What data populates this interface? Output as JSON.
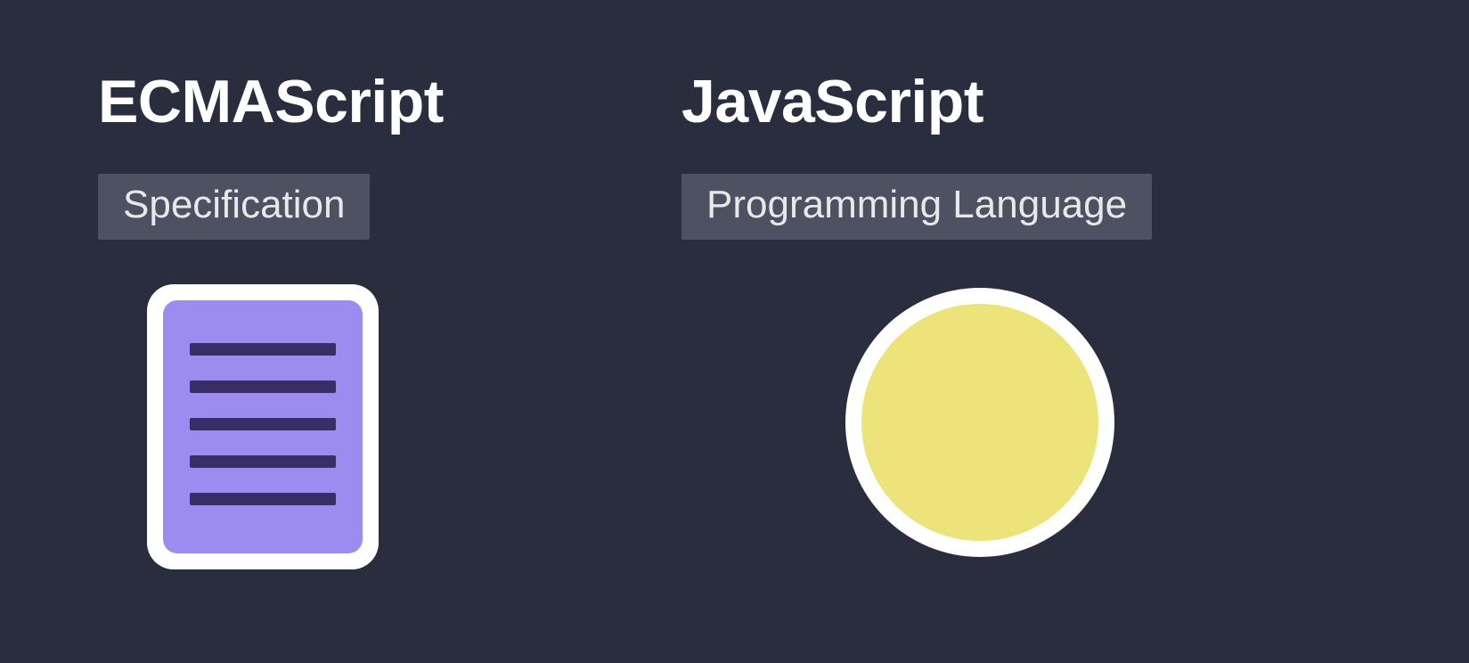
{
  "left": {
    "title": "ECMAScript",
    "label": "Specification",
    "icon": "document-icon",
    "colors": {
      "bg": "#ffffff",
      "fill": "#9c8cf0",
      "lines": "#3a2e68"
    }
  },
  "right": {
    "title": "JavaScript",
    "label": "Programming Language",
    "icon": "circle-icon",
    "colors": {
      "ring": "#ffffff",
      "fill": "#ece37a"
    }
  },
  "background": "#2a2d3e"
}
